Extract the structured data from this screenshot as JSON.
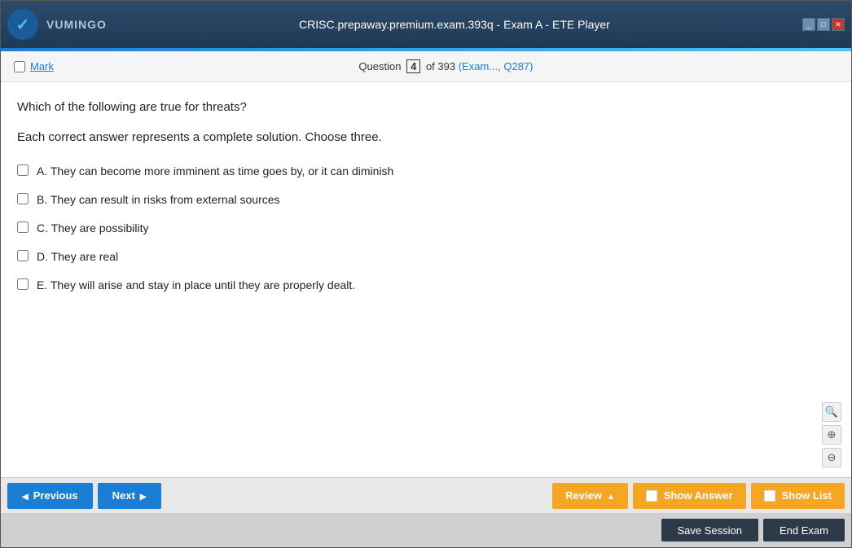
{
  "titleBar": {
    "logoText": "VUMINGO",
    "title": "CRISC.prepaway.premium.exam.393q - Exam A - ETE Player",
    "controls": [
      "minimize",
      "maximize",
      "close"
    ]
  },
  "questionHeader": {
    "markLabel": "Mark",
    "questionLabel": "Question",
    "questionNumber": "4",
    "totalQuestions": "393",
    "examRef": "(Exam..., Q287)"
  },
  "question": {
    "text": "Which of the following are true for threats?",
    "instruction": "Each correct answer represents a complete solution. Choose three.",
    "options": [
      {
        "id": "A",
        "text": "A. They can become more imminent as time goes by, or it can diminish"
      },
      {
        "id": "B",
        "text": "B. They can result in risks from external sources"
      },
      {
        "id": "C",
        "text": "C. They are possibility"
      },
      {
        "id": "D",
        "text": "D. They are real"
      },
      {
        "id": "E",
        "text": "E. They will arise and stay in place until they are properly dealt."
      }
    ]
  },
  "toolbar": {
    "previousLabel": "Previous",
    "nextLabel": "Next",
    "reviewLabel": "Review",
    "showAnswerLabel": "Show Answer",
    "showListLabel": "Show List"
  },
  "actionBar": {
    "saveSessionLabel": "Save Session",
    "endExamLabel": "End Exam"
  },
  "zoom": {
    "searchIcon": "🔍",
    "zoomInIcon": "+",
    "zoomOutIcon": "−"
  }
}
